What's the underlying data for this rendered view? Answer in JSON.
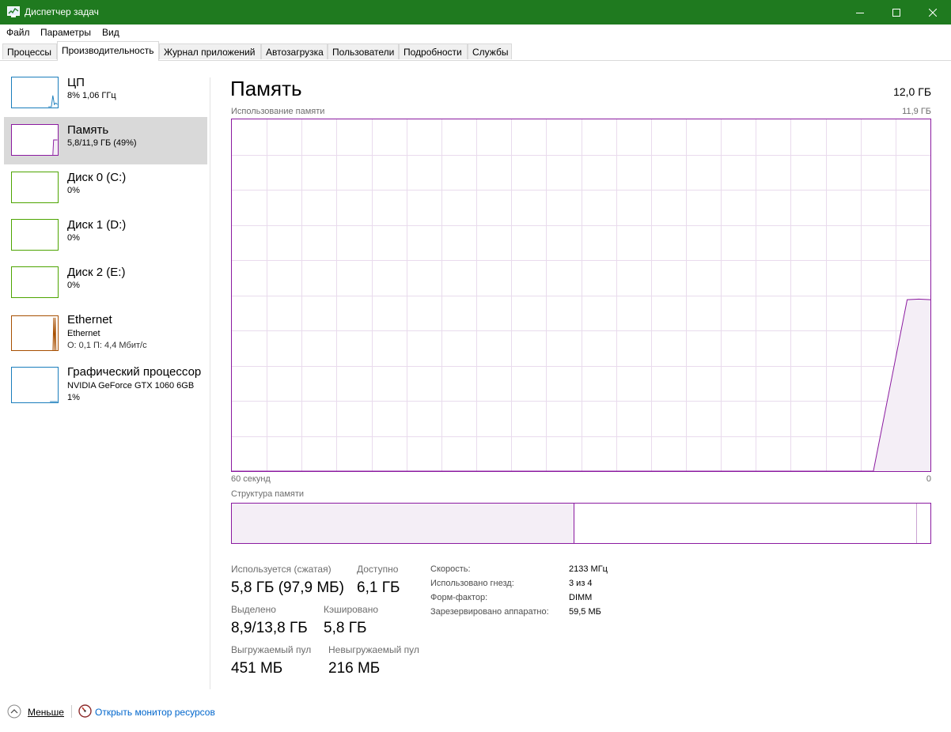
{
  "window": {
    "title": "Диспетчер задач"
  },
  "menu": [
    "Файл",
    "Параметры",
    "Вид"
  ],
  "tabs": [
    {
      "label": "Процессы",
      "active": false
    },
    {
      "label": "Производительность",
      "active": true
    },
    {
      "label": "Журнал приложений",
      "active": false
    },
    {
      "label": "Автозагрузка",
      "active": false
    },
    {
      "label": "Пользователи",
      "active": false
    },
    {
      "label": "Подробности",
      "active": false
    },
    {
      "label": "Службы",
      "active": false
    }
  ],
  "resources": [
    {
      "name": "ЦП",
      "line1": "8% 1,06 ГГц",
      "color": "#1a7dbc"
    },
    {
      "name": "Память",
      "line1": "5,8/11,9 ГБ (49%)",
      "color": "#8b1aa0"
    },
    {
      "name": "Диск 0 (C:)",
      "line1": "0%",
      "color": "#4da400"
    },
    {
      "name": "Диск 1 (D:)",
      "line1": "0%",
      "color": "#4da400"
    },
    {
      "name": "Диск 2 (E:)",
      "line1": "0%",
      "color": "#4da400"
    },
    {
      "name": "Ethernet",
      "line1": "Ethernet",
      "line2": "О: 0,1 П: 4,4 Мбит/с",
      "color": "#a74f01"
    },
    {
      "name": "Графический процессор",
      "line1": "NVIDIA GeForce GTX 1060 6GB",
      "line2": "1%",
      "color": "#1a7dbc"
    }
  ],
  "main": {
    "title": "Память",
    "total": "12,0 ГБ",
    "usage_label": "Использование памяти",
    "usage_max": "11,9 ГБ",
    "time_left": "60 секунд",
    "time_right": "0",
    "composition_label": "Структура памяти"
  },
  "chart_data": {
    "type": "area",
    "title": "Использование памяти",
    "x_range_label": [
      "60 секунд",
      "0"
    ],
    "ymax_label": "11,9 ГБ",
    "x": [
      60,
      4.9,
      2.0,
      1.0,
      0
    ],
    "y": [
      0,
      0,
      5.8,
      5.82,
      5.8
    ],
    "ylim": [
      0,
      11.9
    ],
    "color": "#8b1aa0"
  },
  "composition": {
    "in_use_fraction": 0.49,
    "modified_fraction": 0.003,
    "standby_fraction": 0.487
  },
  "stats": {
    "in_use_label": "Используется (сжатая)",
    "in_use_value": "5,8 ГБ (97,9 МБ)",
    "available_label": "Доступно",
    "available_value": "6,1 ГБ",
    "committed_label": "Выделено",
    "committed_value": "8,9/13,8 ГБ",
    "cached_label": "Кэшировано",
    "cached_value": "5,8 ГБ",
    "paged_label": "Выгружаемый пул",
    "paged_value": "451 МБ",
    "nonpaged_label": "Невыгружаемый пул",
    "nonpaged_value": "216 МБ"
  },
  "props": [
    {
      "label": "Скорость:",
      "value": "2133 МГц"
    },
    {
      "label": "Использовано гнезд:",
      "value": "3 из 4"
    },
    {
      "label": "Форм-фактор:",
      "value": "DIMM"
    },
    {
      "label": "Зарезервировано аппаратно:",
      "value": "59,5 МБ"
    }
  ],
  "footer": {
    "fewer_label": "Меньше",
    "monitor_label": "Открыть монитор ресурсов"
  }
}
